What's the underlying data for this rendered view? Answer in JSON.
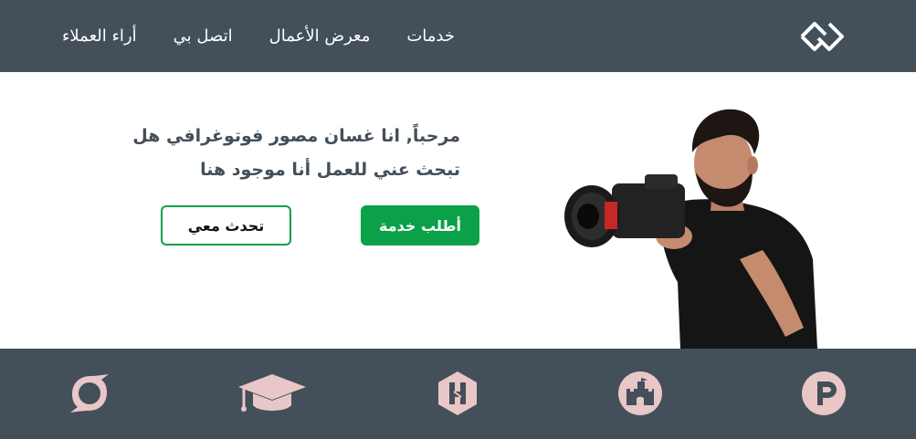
{
  "nav": {
    "links": [
      "خدمات",
      "معرض الأعمال",
      "اتصل بي",
      "أراء العملاء"
    ]
  },
  "hero": {
    "headline": "مرحباً, انا غسان مصور فوتوغرافي هل تبحث عني للعمل أنا موجود هنا",
    "primary_button": "أطلب خدمة",
    "secondary_button": "تحدث معي"
  },
  "footer": {
    "icons": [
      "product-hunt-icon",
      "fort-icon",
      "hackster-icon",
      "graduation-cap-icon",
      "superpowers-icon"
    ]
  },
  "colors": {
    "nav_background": "#434f59",
    "accent_green": "#0aa148",
    "icon_pink": "#e8c7c6",
    "headline_text": "#434f59"
  }
}
